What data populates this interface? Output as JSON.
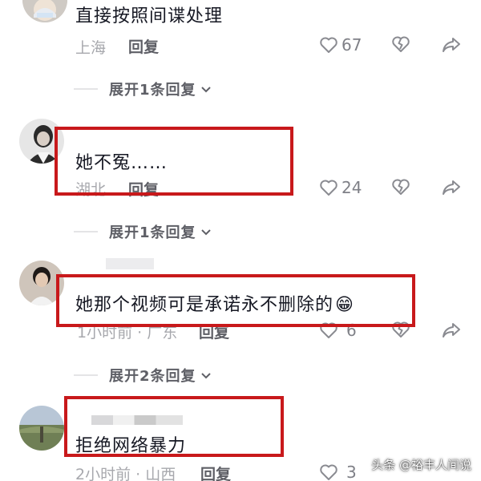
{
  "comments": [
    {
      "text": "直接按照间谍处理",
      "location": "上海",
      "reply": "回复",
      "likes": "67"
    },
    {
      "text": "她不冤……",
      "location": "湖北",
      "reply": "回复",
      "likes": "24"
    },
    {
      "text": "她那个视频可是承诺永不删除的",
      "emoji": "😁",
      "time_location": "1小时前 · 广东",
      "reply": "回复",
      "likes": "6"
    },
    {
      "text": "拒绝网络暴力",
      "time_location": "2小时前 · 山西",
      "reply": "回复",
      "likes": "3"
    }
  ],
  "expanders": [
    {
      "label": "展开1条回复"
    },
    {
      "label": "展开1条回复"
    },
    {
      "label": "展开2条回复"
    }
  ],
  "watermark": "头条 @裕丰人间说",
  "colors": {
    "highlight_box": "#c8191b",
    "meta_text": "#a7a8ad"
  },
  "icons": [
    "heart-icon",
    "dislike-heart-icon",
    "share-icon",
    "chevron-down-icon"
  ]
}
